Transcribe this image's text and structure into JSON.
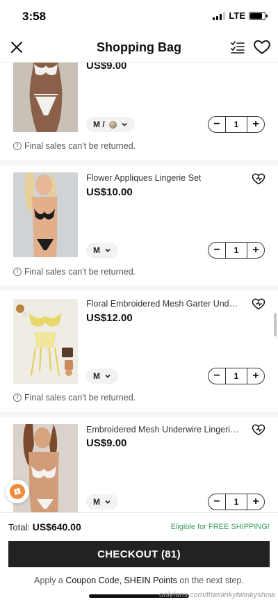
{
  "status_bar": {
    "time": "3:58",
    "network": "LTE",
    "battery_level": 0.85
  },
  "header": {
    "title": "Shopping Bag",
    "icons": {
      "close": "close-icon",
      "list": "checklist-icon",
      "wishlist": "heart-icon"
    }
  },
  "items": [
    {
      "title": "",
      "price": "US$9.00",
      "size": "M /",
      "has_color_swatch": true,
      "quantity": "1",
      "note": "Final sales can't be returned."
    },
    {
      "title": "Flower Appliques Lingerie Set",
      "price": "US$10.00",
      "size": "M",
      "quantity": "1",
      "note": "Final sales can't be returned."
    },
    {
      "title": "Floral Embroidered Mesh Garter Under...",
      "price": "US$12.00",
      "size": "M",
      "quantity": "1",
      "note": "Final sales can't be returned."
    },
    {
      "title": "Embroidered Mesh Underwire Lingerie...",
      "price": "US$9.00",
      "size": "M",
      "quantity": "1"
    }
  ],
  "footer": {
    "total_label": "Total:",
    "total_amount": "US$640.00",
    "free_shipping": "Eligible for FREE SHIPPING!",
    "checkout_label": "CHECKOUT (81)",
    "coupon_prefix": "Apply a",
    "coupon_code": "Coupon Code,",
    "shein_points": "SHEIN Points",
    "coupon_suffix": "on the next step."
  },
  "watermark": "onlyfans.com/thaslinkytwinkyshow",
  "colors": {
    "accent_green": "#3aa15a",
    "checkout_bg": "#222222"
  }
}
